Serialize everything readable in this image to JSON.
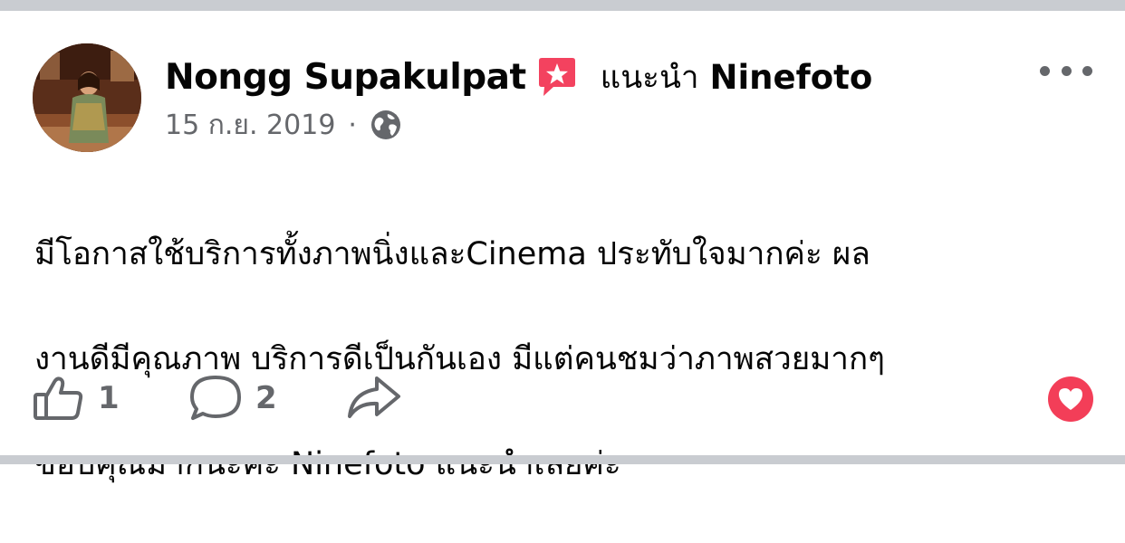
{
  "post": {
    "author_name": "Nongg Supakulpat",
    "recommends_label": "แนะนำ",
    "page_name": "Ninefoto",
    "date": "15 ก.ย. 2019",
    "meta_separator": "·",
    "body_lines": [
      "มีโอกาสใช้บริการทั้งภาพนิ่งและCinema ประทับใจมากค่ะ ผล",
      "งานดีมีคุณภาพ บริการดีเป็นกันเอง มีแต่คนชมว่าภาพสวยมากๆ",
      "ขอบคุณมากนะคะ Ninefoto แนะนำเลยค่ะ"
    ]
  },
  "actions": {
    "like_count": "1",
    "comment_count": "2"
  },
  "icons": {
    "badge": "recommend-star-badge-icon",
    "privacy": "globe-icon",
    "more": "more-horizontal-icon",
    "like": "thumbs-up-icon",
    "comment": "comment-bubble-icon",
    "share": "share-arrow-icon",
    "reaction": "love-heart-icon"
  },
  "colors": {
    "badge": "#f3425f",
    "heart": "#f33e58",
    "secondary_text": "#65676b",
    "primary_text": "#050505",
    "separator_band": "#c9ccd1"
  }
}
